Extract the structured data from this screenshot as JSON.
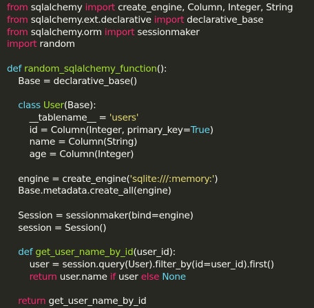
{
  "colors": {
    "background": "#272822",
    "plain": "#f8f8f2",
    "import_keyword": "#f92672",
    "def_keyword": "#66d9ef",
    "function_name": "#a6e22e",
    "string": "#e6db74",
    "constant": "#66d9ef"
  },
  "lines": [
    [
      [
        "kw",
        "from"
      ],
      [
        "plain",
        " sqlalchemy "
      ],
      [
        "kw",
        "import"
      ],
      [
        "plain",
        " create_engine, Column, Integer, String"
      ]
    ],
    [
      [
        "kw",
        "from"
      ],
      [
        "plain",
        " sqlalchemy.ext.declarative "
      ],
      [
        "kw",
        "import"
      ],
      [
        "plain",
        " declarative_base"
      ]
    ],
    [
      [
        "kw",
        "from"
      ],
      [
        "plain",
        " sqlalchemy.orm "
      ],
      [
        "kw",
        "import"
      ],
      [
        "plain",
        " sessionmaker"
      ]
    ],
    [
      [
        "kw",
        "import"
      ],
      [
        "plain",
        " random"
      ]
    ],
    [],
    [
      [
        "kwd",
        "def"
      ],
      [
        "plain",
        " "
      ],
      [
        "fn",
        "random_sqlalchemy_function"
      ],
      [
        "plain",
        "():"
      ]
    ],
    [
      [
        "plain",
        "    Base = declarative_base()"
      ]
    ],
    [],
    [
      [
        "plain",
        "    "
      ],
      [
        "kwd",
        "class"
      ],
      [
        "plain",
        " "
      ],
      [
        "fn",
        "User"
      ],
      [
        "plain",
        "(Base):"
      ]
    ],
    [
      [
        "plain",
        "        __tablename__ = "
      ],
      [
        "str",
        "'users'"
      ]
    ],
    [
      [
        "plain",
        "        id = Column(Integer, primary_key="
      ],
      [
        "bool",
        "True"
      ],
      [
        "plain",
        ")"
      ]
    ],
    [
      [
        "plain",
        "        name = Column(String)"
      ]
    ],
    [
      [
        "plain",
        "        age = Column(Integer)"
      ]
    ],
    [],
    [
      [
        "plain",
        "    engine = create_engine("
      ],
      [
        "str",
        "'sqlite:///:memory:'"
      ],
      [
        "plain",
        ")"
      ]
    ],
    [
      [
        "plain",
        "    Base.metadata.create_all(engine)"
      ]
    ],
    [],
    [
      [
        "plain",
        "    Session = sessionmaker(bind=engine)"
      ]
    ],
    [
      [
        "plain",
        "    session = Session()"
      ]
    ],
    [],
    [
      [
        "plain",
        "    "
      ],
      [
        "kwd",
        "def"
      ],
      [
        "plain",
        " "
      ],
      [
        "fn",
        "get_user_name_by_id"
      ],
      [
        "plain",
        "(user_id):"
      ]
    ],
    [
      [
        "plain",
        "        user = session.query(User).filter_by(id=user_id).first()"
      ]
    ],
    [
      [
        "plain",
        "        "
      ],
      [
        "kw",
        "return"
      ],
      [
        "plain",
        " user.name "
      ],
      [
        "kw",
        "if"
      ],
      [
        "plain",
        " user "
      ],
      [
        "kw",
        "else"
      ],
      [
        "plain",
        " "
      ],
      [
        "bool",
        "None"
      ]
    ],
    [],
    [
      [
        "plain",
        "    "
      ],
      [
        "kw",
        "return"
      ],
      [
        "plain",
        " get_user_name_by_id"
      ]
    ]
  ]
}
